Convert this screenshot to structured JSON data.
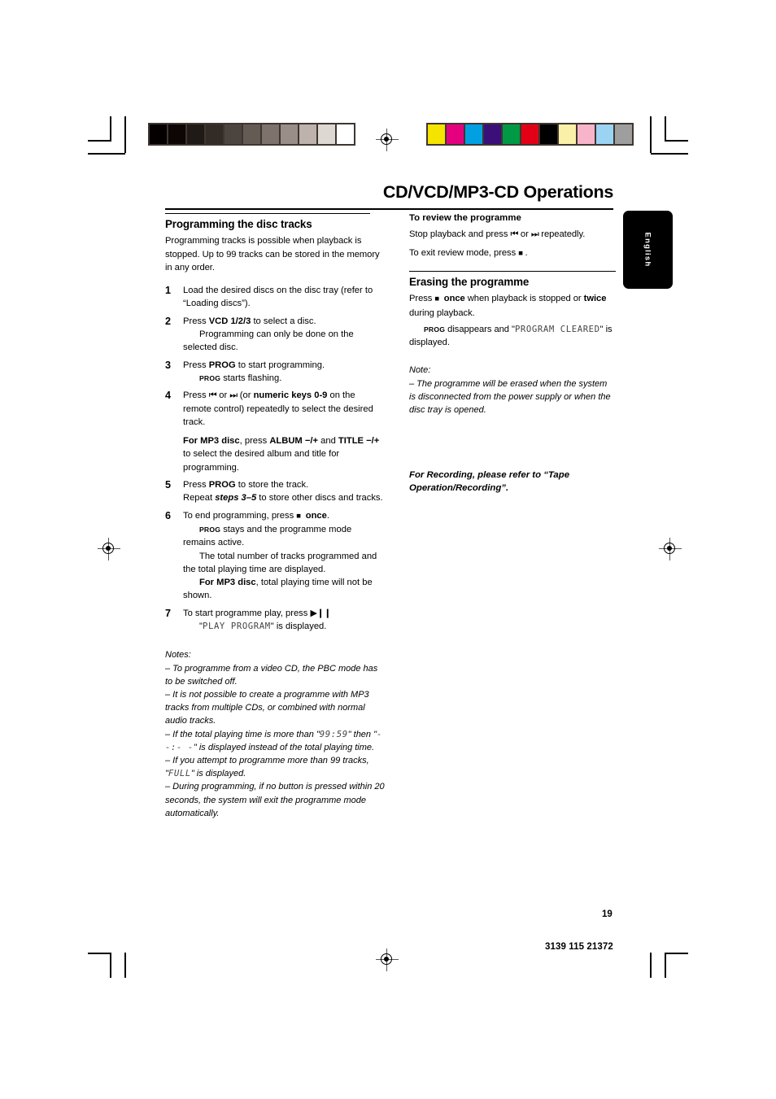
{
  "page": {
    "title": "CD/VCD/MP3-CD Operations",
    "language_tab": "English",
    "page_number": "19",
    "document_code": "3139 115 21372"
  },
  "calibration": {
    "grayscale_label": "grayscale-bar",
    "grayscale": [
      "#040000",
      "#0d0605",
      "#201a16",
      "#332b25",
      "#4c443e",
      "#635b54",
      "#7d736c",
      "#998f88",
      "#bdb3ac",
      "#ded8d2",
      "#ffffff"
    ],
    "colors": [
      "#f5e400",
      "#e4007f",
      "#00a0e2",
      "#3a0f7a",
      "#009944",
      "#e30016",
      "#000000",
      "#fbf0a8",
      "#f8b5ca",
      "#9bd3f2",
      "#9e9e9e"
    ]
  },
  "left_column": {
    "heading": "Programming the disc tracks",
    "intro": "Programming tracks is possible when playback is stopped. Up to 99 tracks can be stored in the memory in any order.",
    "steps": [
      {
        "num": "1",
        "lines": [
          "Load the desired discs on the disc tray (refer to “Loading discs”)."
        ]
      },
      {
        "num": "2",
        "lines": [
          "Press VCD 1/2/3 to select a disc.",
          "Programming can only be done on the selected disc."
        ]
      },
      {
        "num": "3",
        "lines": [
          "Press PROG to start programming.",
          "PROG starts flashing."
        ]
      },
      {
        "num": "4",
        "lines": [
          "Press ⏮ or ⏭ (or numeric keys 0-9 on the remote control) repeatedly to select the desired track.",
          "For MP3 disc, press ALBUM −/+ and TITLE −/+ to select the desired album and title for programming."
        ]
      },
      {
        "num": "5",
        "lines": [
          "Press PROG to store the track.",
          "Repeat steps 3–5 to store other discs and tracks."
        ]
      },
      {
        "num": "6",
        "lines": [
          "To end programming, press ■ once.",
          "PROG stays and the programme mode remains active.",
          "The total number of tracks programmed and the total playing time are displayed.",
          "For MP3 disc, total playing time will not be shown."
        ]
      },
      {
        "num": "7",
        "lines": [
          "To start programme play, press ▶Ⅱ",
          "\"PLAY PROGRAM\" is displayed."
        ]
      }
    ],
    "step1_text": "Load the desired discs on the disc tray (refer to “Loading discs”).",
    "step2_a_pre": "Press ",
    "step2_a_bold": "VCD 1/2/3",
    "step2_a_post": " to select a disc.",
    "step2_b": "Programming can only be done on the selected disc.",
    "step3_a_pre": "Press ",
    "step3_a_bold": "PROG",
    "step3_a_post": " to start programming.",
    "step3_b_sc": "PROG",
    "step3_b_post": " starts flashing.",
    "step4_a_pre": "Press ",
    "step4_a_mid": " or ",
    "step4_a_bold": "numeric keys 0-9",
    "step4_a_post": " on the remote control) repeatedly to select the desired track.",
    "step4_a_paren": " (or ",
    "step4_b_bold1": "For MP3 disc",
    "step4_b_mid1": ", press ",
    "step4_b_bold2": "ALBUM",
    "step4_b_sign1": " −/+ ",
    "step4_b_mid2": "and ",
    "step4_b_bold3": "TITLE",
    "step4_b_sign2": " −/+ ",
    "step4_b_post": "to select the desired album and title for programming.",
    "step5_a_pre": "Press ",
    "step5_a_bold": "PROG",
    "step5_a_post": " to store the track.",
    "step5_b_pre": "Repeat ",
    "step5_b_bold": "steps 3–5",
    "step5_b_post": " to store other discs and tracks.",
    "step6_a_pre": "To end programming, press ",
    "step6_a_bold": "once",
    "step6_a_post": ".",
    "step6_b_sc": "PROG",
    "step6_b_post": " stays and the programme mode remains active.",
    "step6_c": "The total number of tracks programmed and the total playing time are displayed.",
    "step6_d_bold": "For MP3 disc",
    "step6_d_post": ", total playing time will not be shown.",
    "step7_a": "To start programme play, press ",
    "step7_b_q1": "\"",
    "step7_b_lcd": "PLAY PROGRAM",
    "step7_b_q2": "\" is displayed.",
    "notes_label": "Notes:",
    "notes": [
      "–  To programme from a video CD, the PBC mode has to be switched off.",
      "–  It is not possible to create a programme with MP3 tracks from multiple CDs, or combined with normal audio tracks."
    ],
    "note3_pre": "–  If the total playing time is more than \"",
    "note3_lcd1": "99:59",
    "note3_mid": "\" then \"",
    "note3_lcd2": "- -:- -",
    "note3_post": "\" is displayed instead of the total playing time.",
    "note4_pre": "–  If you attempt to programme more than 99 tracks, \"",
    "note4_lcd": "FULL",
    "note4_post": "\" is displayed.",
    "note5": "–  During programming, if no button is pressed within 20 seconds, the system will exit the programme mode automatically."
  },
  "right_column": {
    "review_heading": "To review the programme",
    "review_line1_pre": "Stop playback and press ",
    "review_line1_mid": " or ",
    "review_line1_post": " repeatedly.",
    "review_line2_pre": "To exit review mode, press ",
    "review_line2_post": " .",
    "erase_heading": "Erasing the programme",
    "erase_line1_pre": "Press ",
    "erase_line1_bold1": "once",
    "erase_line1_mid": " when playback is stopped or ",
    "erase_line1_bold2": "twice",
    "erase_line1_post": " during playback.",
    "erase_line2_sc": "PROG",
    "erase_line2_mid": " disappears and \"",
    "erase_line2_lcd": "PROGRAM CLEARED",
    "erase_line2_post": "\" is displayed.",
    "note_label": "Note:",
    "note_text": "–  The programme will be erased when the system is disconnected from the power supply or when the disc tray is opened.",
    "recording_note": "For Recording, please refer to “Tape Operation/Recording”."
  }
}
